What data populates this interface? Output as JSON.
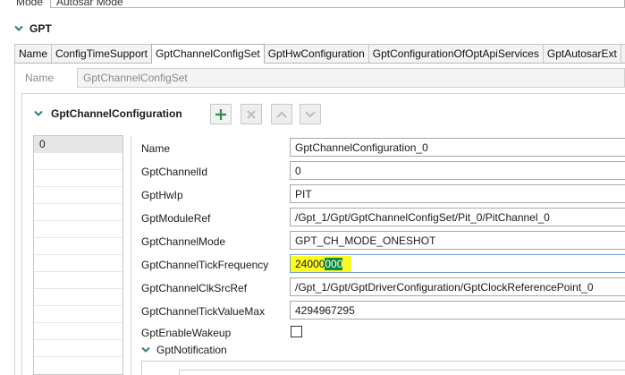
{
  "mode": {
    "label": "Mode",
    "value": "Autosar Mode"
  },
  "section": {
    "title": "GPT"
  },
  "tabs": [
    {
      "label": "Name"
    },
    {
      "label": "ConfigTimeSupport"
    },
    {
      "label": "GptChannelConfigSet",
      "active": true
    },
    {
      "label": "GptHwConfiguration"
    },
    {
      "label": "GptConfigurationOfOptApiServices"
    },
    {
      "label": "GptAutosarExt"
    },
    {
      "label": "G"
    }
  ],
  "name_row": {
    "label": "Name",
    "value": "GptChannelConfigSet"
  },
  "channel_config": {
    "title": "GptChannelConfiguration",
    "toolbar": {
      "add_icon": "plus-icon",
      "delete_icon": "x-icon",
      "up_icon": "chevron-up-icon",
      "down_icon": "chevron-down-icon"
    },
    "list": [
      "0"
    ]
  },
  "properties": [
    {
      "label": "Name",
      "value": "GptChannelConfiguration_0"
    },
    {
      "label": "GptChannelId",
      "value": "0"
    },
    {
      "label": "GptHwIp",
      "value": "PIT"
    },
    {
      "label": "GptModuleRef",
      "value": "/Gpt_1/Gpt/GptChannelConfigSet/Pit_0/PitChannel_0"
    },
    {
      "label": "GptChannelMode",
      "value": "GPT_CH_MODE_ONESHOT"
    },
    {
      "label": "GptChannelTickFrequency",
      "value_part1": "24000",
      "value_part2": "000"
    },
    {
      "label": "GptChannelClkSrcRef",
      "value": "/Gpt_1/Gpt/GptDriverConfiguration/GptClockReferencePoint_0"
    },
    {
      "label": "GptChannelTickValueMax",
      "value": "4294967295"
    },
    {
      "label": "GptEnableWakeup",
      "checked": false
    }
  ],
  "notification": {
    "title": "GptNotification"
  },
  "colors": {
    "highlight_yellow": "#fafa28",
    "selection_green": "#0f8a3c",
    "add_icon_green": "#2e8b57",
    "chevron_teal": "#2f7f7f"
  }
}
